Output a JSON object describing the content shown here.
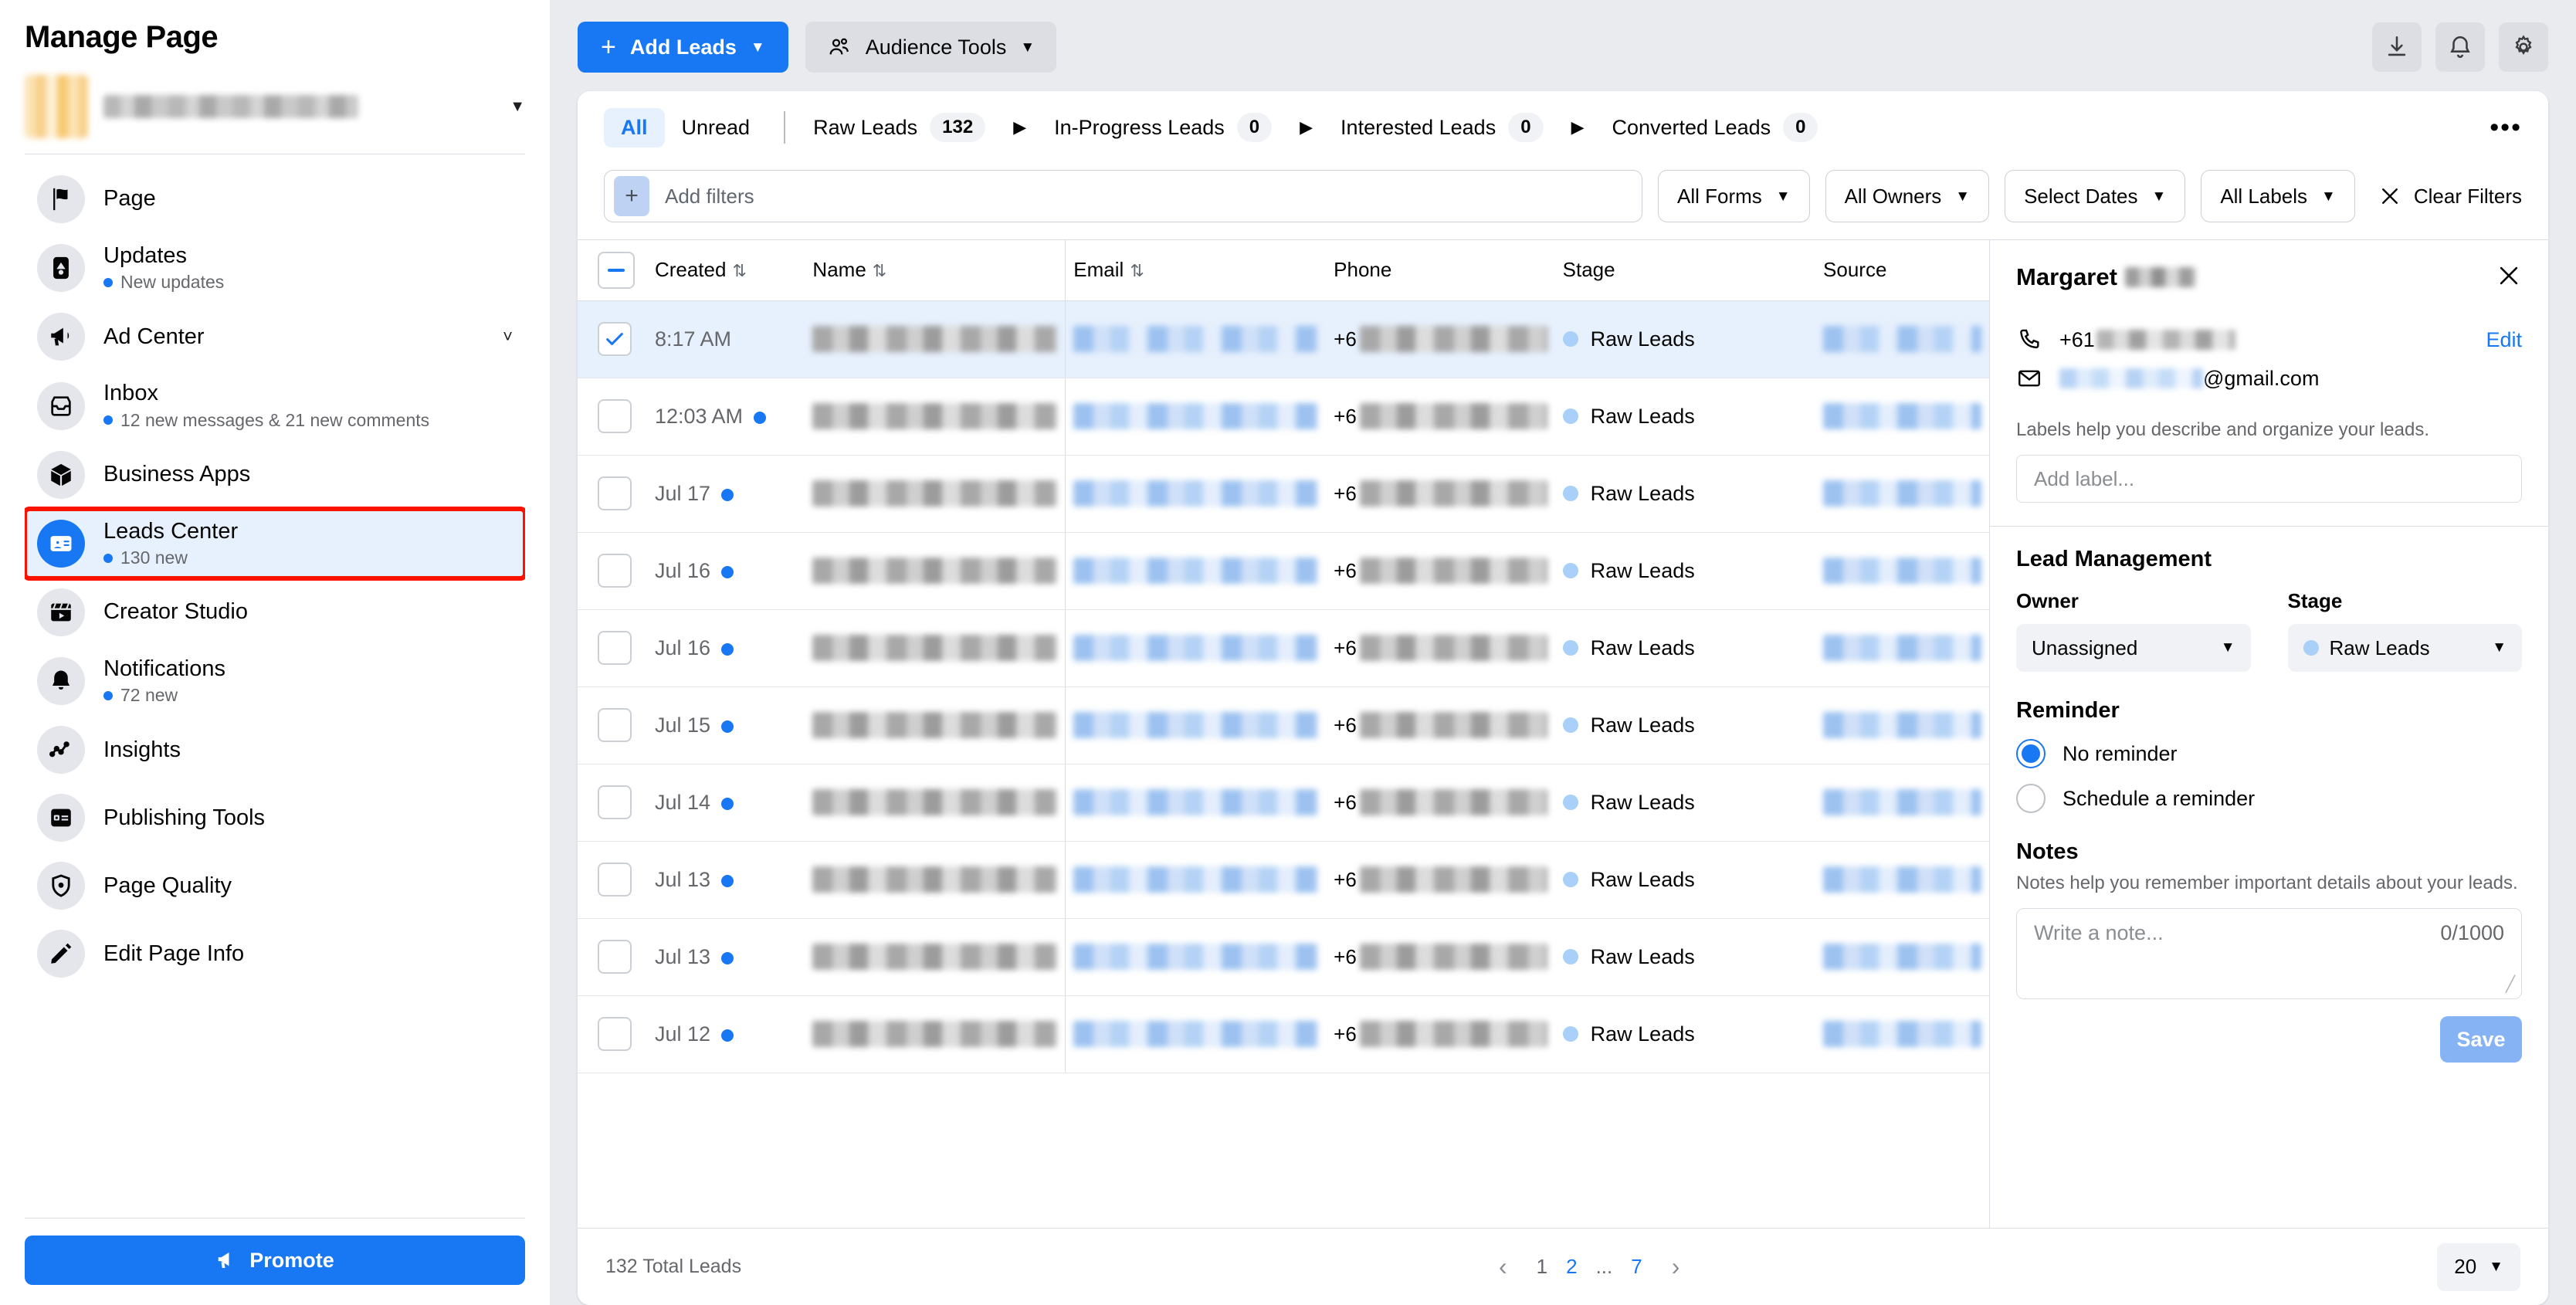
{
  "sidebar": {
    "title": "Manage Page",
    "page_name_masked": "",
    "items": [
      {
        "label": "Page",
        "sub": "",
        "icon": "flag-icon"
      },
      {
        "label": "Updates",
        "sub": "New updates",
        "icon": "updates-icon"
      },
      {
        "label": "Ad Center",
        "sub": "",
        "icon": "megaphone-icon",
        "chevron": "⌄"
      },
      {
        "label": "Inbox",
        "sub": "12 new messages & 21 new comments",
        "icon": "inbox-icon"
      },
      {
        "label": "Business Apps",
        "sub": "",
        "icon": "cube-icon"
      },
      {
        "label": "Leads Center",
        "sub": "130 new",
        "icon": "contact-card-icon"
      },
      {
        "label": "Creator Studio",
        "sub": "",
        "icon": "clapperboard-icon"
      },
      {
        "label": "Notifications",
        "sub": "72 new",
        "icon": "bell-icon"
      },
      {
        "label": "Insights",
        "sub": "",
        "icon": "line-chart-icon"
      },
      {
        "label": "Publishing Tools",
        "sub": "",
        "icon": "publishing-icon"
      },
      {
        "label": "Page Quality",
        "sub": "",
        "icon": "shield-icon"
      },
      {
        "label": "Edit Page Info",
        "sub": "",
        "icon": "pencil-icon"
      }
    ],
    "promote_label": "Promote"
  },
  "toolbar": {
    "add_leads_label": "Add Leads",
    "audience_tools_label": "Audience Tools",
    "download_icon": "download-icon",
    "bell_icon": "bell-icon",
    "gear_icon": "gear-icon"
  },
  "tabs": {
    "all": "All",
    "unread": "Unread",
    "stages": [
      {
        "label": "Raw Leads",
        "count": "132"
      },
      {
        "label": "In-Progress Leads",
        "count": "0"
      },
      {
        "label": "Interested Leads",
        "count": "0"
      },
      {
        "label": "Converted Leads",
        "count": "0"
      }
    ],
    "more": "•••"
  },
  "filters": {
    "add_filters_placeholder": "Add filters",
    "plus": "+",
    "forms": "All Forms",
    "owners": "All Owners",
    "dates": "Select Dates",
    "labels": "All Labels",
    "clear": "Clear Filters"
  },
  "table": {
    "columns": [
      "Created",
      "Name",
      "Email",
      "Phone",
      "Stage",
      "Source"
    ],
    "rows": [
      {
        "created": "8:17 AM",
        "unread": false,
        "stage": "Raw Leads",
        "selected": true
      },
      {
        "created": "12:03 AM",
        "unread": true,
        "stage": "Raw Leads",
        "selected": false
      },
      {
        "created": "Jul 17",
        "unread": true,
        "stage": "Raw Leads",
        "selected": false
      },
      {
        "created": "Jul 16",
        "unread": true,
        "stage": "Raw Leads",
        "selected": false
      },
      {
        "created": "Jul 16",
        "unread": true,
        "stage": "Raw Leads",
        "selected": false
      },
      {
        "created": "Jul 15",
        "unread": true,
        "stage": "Raw Leads",
        "selected": false
      },
      {
        "created": "Jul 14",
        "unread": true,
        "stage": "Raw Leads",
        "selected": false
      },
      {
        "created": "Jul 13",
        "unread": true,
        "stage": "Raw Leads",
        "selected": false
      },
      {
        "created": "Jul 13",
        "unread": true,
        "stage": "Raw Leads",
        "selected": false
      },
      {
        "created": "Jul 12",
        "unread": true,
        "stage": "Raw Leads",
        "selected": false
      }
    ]
  },
  "footer": {
    "total": "132 Total Leads",
    "prev": "‹",
    "next": "›",
    "pages": [
      "1",
      "2",
      "...",
      "7"
    ],
    "per_page": "20"
  },
  "detail": {
    "name": "Margaret",
    "phone_prefix": "+61",
    "email_domain": "@gmail.com",
    "edit": "Edit",
    "labels_hint": "Labels help you describe and organize your leads.",
    "add_label_placeholder": "Add label...",
    "lead_management": "Lead Management",
    "owner_label": "Owner",
    "owner_value": "Unassigned",
    "stage_label": "Stage",
    "stage_value": "Raw Leads",
    "reminder_label": "Reminder",
    "reminder_none": "No reminder",
    "reminder_schedule": "Schedule a reminder",
    "notes_label": "Notes",
    "notes_hint": "Notes help you remember important details about your leads.",
    "note_placeholder": "Write a note...",
    "note_count": "0/1000",
    "save": "Save"
  },
  "colors": {
    "accent": "#1877f2",
    "highlight_box": "#fb1300",
    "selected_row": "#e7f0fd",
    "stage_dot": "#a8d0f8"
  }
}
